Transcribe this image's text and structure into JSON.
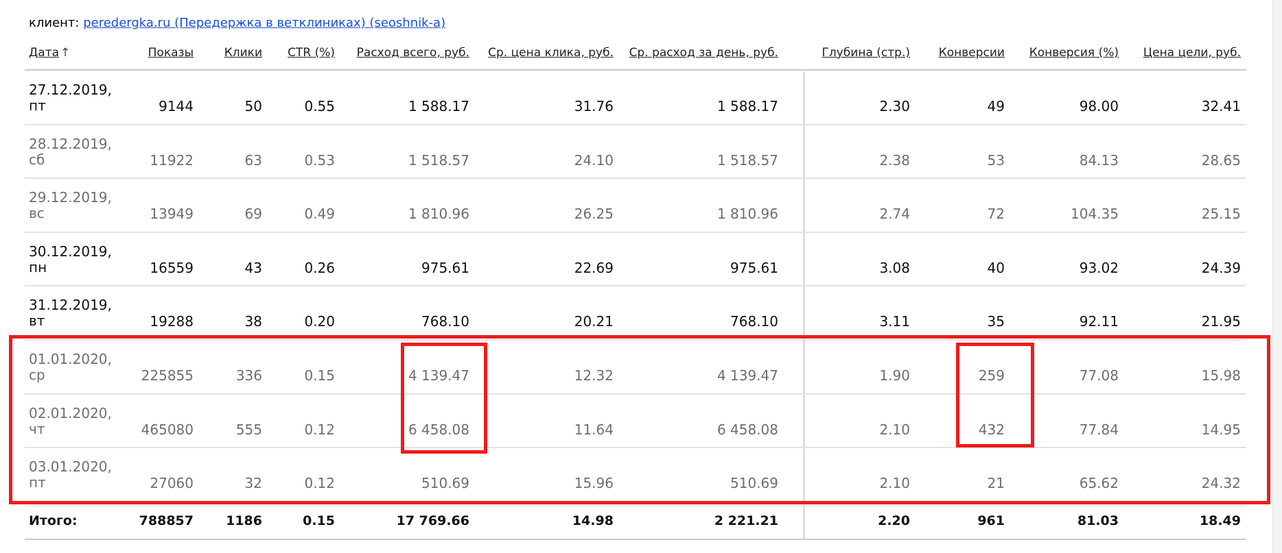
{
  "client": {
    "prefix": "клиент:",
    "link_text": "peredergka.ru (Передержка в ветклиниках) (seoshnik-a)"
  },
  "columns": [
    {
      "key": "date",
      "label": "Дата"
    },
    {
      "key": "shows",
      "label": "Показы"
    },
    {
      "key": "clicks",
      "label": "Клики"
    },
    {
      "key": "ctr",
      "label": "CTR (%)"
    },
    {
      "key": "spend",
      "label": "Расход всего, руб."
    },
    {
      "key": "cpc",
      "label": "Ср. цена клика, руб."
    },
    {
      "key": "daily_spend",
      "label": "Ср. расход за день, руб."
    },
    {
      "key": "depth",
      "label": "Глубина (стр.)"
    },
    {
      "key": "conversions",
      "label": "Конверсии"
    },
    {
      "key": "conv_rate",
      "label": "Конверсия (%)"
    },
    {
      "key": "goal_cost",
      "label": "Цена цели, руб."
    }
  ],
  "sort_indicator": "↑",
  "rows": [
    {
      "date": "27.12.2019,",
      "day": "пт",
      "shows": "9144",
      "clicks": "50",
      "ctr": "0.55",
      "spend": "1 588.17",
      "cpc": "31.76",
      "daily_spend": "1 588.17",
      "depth": "2.30",
      "conversions": "49",
      "conv_rate": "98.00",
      "goal_cost": "32.41"
    },
    {
      "date": "28.12.2019,",
      "day": "сб",
      "shows": "11922",
      "clicks": "63",
      "ctr": "0.53",
      "spend": "1 518.57",
      "cpc": "24.10",
      "daily_spend": "1 518.57",
      "depth": "2.38",
      "conversions": "53",
      "conv_rate": "84.13",
      "goal_cost": "28.65"
    },
    {
      "date": "29.12.2019,",
      "day": "вс",
      "shows": "13949",
      "clicks": "69",
      "ctr": "0.49",
      "spend": "1 810.96",
      "cpc": "26.25",
      "daily_spend": "1 810.96",
      "depth": "2.74",
      "conversions": "72",
      "conv_rate": "104.35",
      "goal_cost": "25.15"
    },
    {
      "date": "30.12.2019,",
      "day": "пн",
      "shows": "16559",
      "clicks": "43",
      "ctr": "0.26",
      "spend": "975.61",
      "cpc": "22.69",
      "daily_spend": "975.61",
      "depth": "3.08",
      "conversions": "40",
      "conv_rate": "93.02",
      "goal_cost": "24.39"
    },
    {
      "date": "31.12.2019,",
      "day": "вт",
      "shows": "19288",
      "clicks": "38",
      "ctr": "0.20",
      "spend": "768.10",
      "cpc": "20.21",
      "daily_spend": "768.10",
      "depth": "3.11",
      "conversions": "35",
      "conv_rate": "92.11",
      "goal_cost": "21.95"
    },
    {
      "date": "01.01.2020,",
      "day": "ср",
      "shows": "225855",
      "clicks": "336",
      "ctr": "0.15",
      "spend": "4 139.47",
      "cpc": "12.32",
      "daily_spend": "4 139.47",
      "depth": "1.90",
      "conversions": "259",
      "conv_rate": "77.08",
      "goal_cost": "15.98"
    },
    {
      "date": "02.01.2020,",
      "day": "чт",
      "shows": "465080",
      "clicks": "555",
      "ctr": "0.12",
      "spend": "6 458.08",
      "cpc": "11.64",
      "daily_spend": "6 458.08",
      "depth": "2.10",
      "conversions": "432",
      "conv_rate": "77.84",
      "goal_cost": "14.95"
    },
    {
      "date": "03.01.2020,",
      "day": "пт",
      "shows": "27060",
      "clicks": "32",
      "ctr": "0.12",
      "spend": "510.69",
      "cpc": "15.96",
      "daily_spend": "510.69",
      "depth": "2.10",
      "conversions": "21",
      "conv_rate": "65.62",
      "goal_cost": "24.32"
    }
  ],
  "totals": {
    "label": "Итого:",
    "shows": "788857",
    "clicks": "1186",
    "ctr": "0.15",
    "spend": "17 769.66",
    "cpc": "14.98",
    "daily_spend": "2 221.21",
    "depth": "2.20",
    "conversions": "961",
    "conv_rate": "81.03",
    "goal_cost": "18.49"
  },
  "colors": {
    "link": "#1a4fd8",
    "highlight": "#ee1c1c",
    "weekday_text": "#111111",
    "weekend_text": "#6e6e6e"
  }
}
